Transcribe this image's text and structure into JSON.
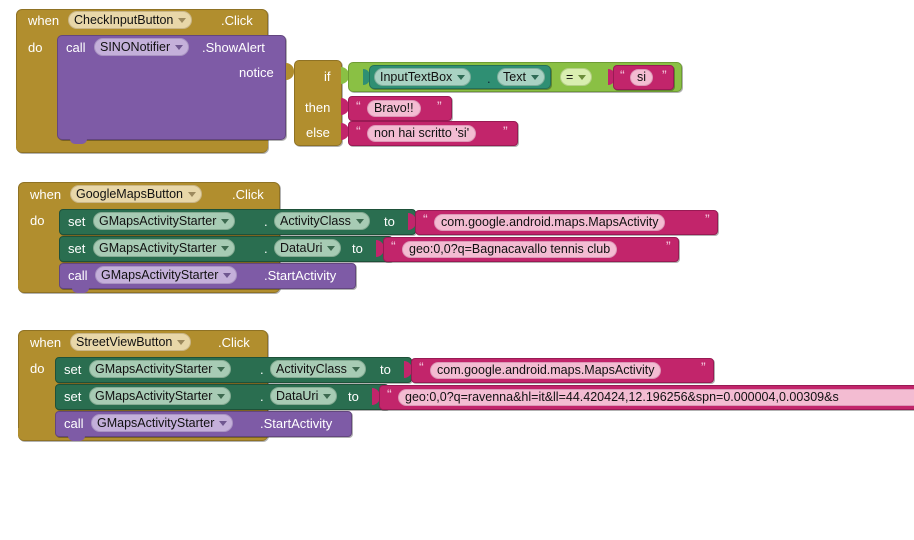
{
  "app": {
    "editor": "MIT App Inventor Blocks Editor",
    "background_color": "#ffffff"
  },
  "colors": {
    "event_gold": "#b18e2e",
    "method_purple": "#7e5ba6",
    "setter_green": "#2a6e50",
    "logic_green": "#8ac044",
    "text_magenta": "#c2256b"
  },
  "blocks": [
    {
      "id": "group-1",
      "event": {
        "when_label": "when",
        "component": "CheckInputButton",
        "event_name": ".Click",
        "do_label": "do"
      },
      "call": {
        "call_label": "call",
        "component": "SINONotifier",
        "method": ".ShowAlert",
        "arg_label": "notice"
      },
      "control_if": {
        "if_label": "if",
        "then_label": "then",
        "else_label": "else",
        "condition": {
          "left_component": "InputTextBox",
          "dot": ".",
          "left_property": "Text",
          "operator": "=",
          "right_text": "si"
        },
        "then_text": "Bravo!!",
        "else_text": "non hai scritto 'si'"
      }
    },
    {
      "id": "group-2",
      "event": {
        "when_label": "when",
        "component": "GoogleMapsButton",
        "event_name": ".Click",
        "do_label": "do"
      },
      "statements": [
        {
          "kind": "set",
          "set_label": "set",
          "component": "GMapsActivityStarter",
          "dot": ".",
          "property": "ActivityClass",
          "to_label": "to",
          "value": "com.google.android.maps.MapsActivity"
        },
        {
          "kind": "set",
          "set_label": "set",
          "component": "GMapsActivityStarter",
          "dot": ".",
          "property": "DataUri",
          "to_label": "to",
          "value": "geo:0,0?q=Bagnacavallo tennis club"
        },
        {
          "kind": "call",
          "call_label": "call",
          "component": "GMapsActivityStarter",
          "method": ".StartActivity"
        }
      ]
    },
    {
      "id": "group-3",
      "event": {
        "when_label": "when",
        "component": "StreetViewButton",
        "event_name": ".Click",
        "do_label": "do"
      },
      "statements": [
        {
          "kind": "set",
          "set_label": "set",
          "component": "GMapsActivityStarter",
          "dot": ".",
          "property": "ActivityClass",
          "to_label": "to",
          "value": "com.google.android.maps.MapsActivity"
        },
        {
          "kind": "set",
          "set_label": "set",
          "component": "GMapsActivityStarter",
          "dot": ".",
          "property": "DataUri",
          "to_label": "to",
          "value": "geo:0,0?q=ravenna&hl=it&ll=44.420424,12.196256&spn=0.000004,0.00309&s"
        },
        {
          "kind": "call",
          "call_label": "call",
          "component": "GMapsActivityStarter",
          "method": ".StartActivity"
        }
      ]
    }
  ]
}
